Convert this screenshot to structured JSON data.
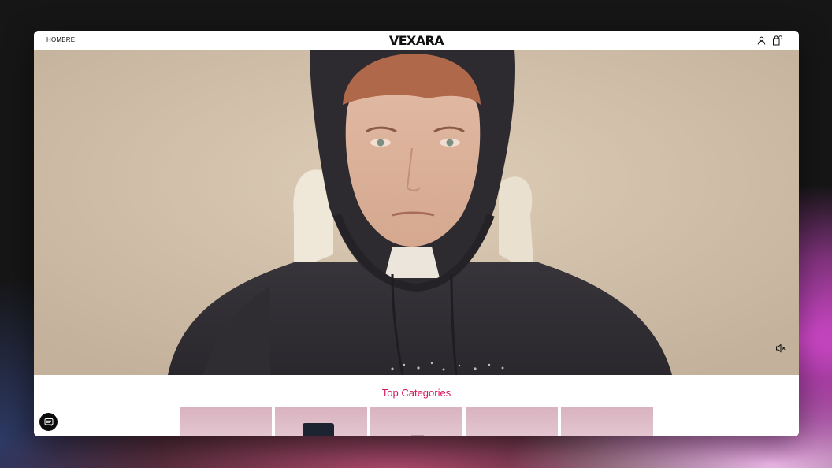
{
  "header": {
    "nav_label": "HOMBRE",
    "logo_text": "VEXARA",
    "icons": [
      "account-icon",
      "shopping-bag-icon"
    ]
  },
  "hero": {
    "media": "video",
    "mute_icon": "volume-muted-icon"
  },
  "categories": {
    "title": "Top Categories",
    "items": [
      {
        "image": "category-image"
      },
      {
        "image": "category-image-jeans"
      },
      {
        "image": "category-image"
      },
      {
        "image": "category-image"
      },
      {
        "image": "category-image"
      }
    ]
  },
  "chat": {
    "icon": "chat-icon"
  },
  "colors": {
    "accent": "#d8155f",
    "header_bg": "#ffffff",
    "text": "#111111",
    "hoodie": "#3a373c",
    "backdrop": "#d4c3ad"
  }
}
